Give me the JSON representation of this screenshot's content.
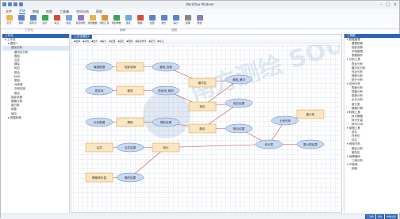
{
  "window": {
    "title": "Workflow Modeler"
  },
  "menu": [
    "文件",
    "开始",
    "数据",
    "地图",
    "工具箱",
    "空间分析",
    "帮助"
  ],
  "ribbon": {
    "tools": [
      {
        "label": "打开",
        "color": "#e8b64a"
      },
      {
        "label": "保存",
        "color": "#5b84c4"
      },
      {
        "label": "另存为",
        "color": "#5b84c4"
      },
      {
        "label": "运行",
        "color": "#3aa655"
      },
      {
        "label": "停止",
        "color": "#d84b3b"
      },
      {
        "label": "验证",
        "color": "#6fa8dc"
      },
      {
        "label": "自动布局",
        "color": "#8e7cc3"
      },
      {
        "label": "添加数据",
        "color": "#e8b64a"
      },
      {
        "label": "添加工具",
        "color": "#e0913b"
      },
      {
        "label": "添加参数",
        "color": "#3aa655"
      },
      {
        "label": "连接",
        "color": "#6fa8dc"
      },
      {
        "label": "删除",
        "color": "#d84b3b"
      },
      {
        "label": "全图",
        "color": "#5b84c4"
      },
      {
        "label": "放大",
        "color": "#5b84c4"
      },
      {
        "label": "缩小",
        "color": "#5b84c4"
      },
      {
        "label": "选择",
        "color": "#888888"
      },
      {
        "label": "属性",
        "color": "#8e7cc3"
      }
    ],
    "groups": [
      "工作流",
      "编辑",
      "视图"
    ]
  },
  "left_panel": {
    "title": "工作流",
    "items": [
      "工作流",
      "模型1",
      "叠加分析",
      "缓冲区分析",
      "裁剪",
      "合并",
      "擦除",
      "相交",
      "联合",
      "标识",
      "更新",
      "对称差",
      "空间连接",
      "融合",
      "投影变换",
      "栅格计算",
      "重分类",
      "坡度",
      "坡向",
      "数据转换"
    ]
  },
  "canvas": {
    "tab": "工作流模型1",
    "toolbar": [
      "选择",
      "平移",
      "放大",
      "缩小",
      "全图",
      "连接",
      "删除",
      "自动布局",
      "运行",
      "停止"
    ],
    "nodes": [
      {
        "kind": "data",
        "label": "道路数据"
      },
      {
        "kind": "tool",
        "label": "投影变换"
      },
      {
        "kind": "data",
        "label": "道路_投影"
      },
      {
        "kind": "tool",
        "label": "缓冲区"
      },
      {
        "kind": "data",
        "label": "道路_缓冲"
      },
      {
        "kind": "data",
        "label": "居民地"
      },
      {
        "kind": "tool",
        "label": "裁剪"
      },
      {
        "kind": "data",
        "label": "居民地_裁剪"
      },
      {
        "kind": "tool",
        "label": "相交"
      },
      {
        "kind": "data",
        "label": "相交结果"
      },
      {
        "kind": "tool",
        "label": "融合"
      },
      {
        "kind": "data",
        "label": "融合结果"
      },
      {
        "kind": "data",
        "label": "水系数据"
      },
      {
        "kind": "tool",
        "label": "擦除"
      },
      {
        "kind": "data",
        "label": "擦除结果"
      },
      {
        "kind": "tool",
        "label": "合并"
      },
      {
        "kind": "data",
        "label": "合并结果"
      },
      {
        "kind": "tool",
        "label": "统计"
      },
      {
        "kind": "data",
        "label": "统计表"
      },
      {
        "kind": "data",
        "label": "土地利用"
      },
      {
        "kind": "tool",
        "label": "重分类"
      },
      {
        "kind": "data",
        "label": "重分类结果"
      },
      {
        "kind": "tool",
        "label": "栅格转矢量"
      },
      {
        "kind": "data",
        "label": "最终结果"
      }
    ]
  },
  "right_panel": {
    "title": "工具箱",
    "items": [
      "数据管理",
      "要素转换",
      "投影变换",
      "字段管理",
      "表格操作",
      "分析工具",
      "叠加分析",
      "缓冲区分析",
      "邻近分析",
      "提取分析",
      "统计分析",
      "空间分析",
      "表面分析",
      "插值分析",
      "距离分析",
      "水文分析",
      "重分类",
      "栅格计算",
      "转换工具",
      "转为栅格",
      "转为矢量",
      "转为CAD",
      "制图工具",
      "综合",
      "符号化",
      "标注",
      "网络分析",
      "路径分析",
      "服务区",
      "地理编码",
      "三维分析",
      "可视域",
      "剖面"
    ]
  },
  "statusbar": {
    "tabs": [
      "工具箱",
      "属性",
      "参数设置"
    ]
  },
  "watermark": "南方测绘 SOUTH SURVEY"
}
